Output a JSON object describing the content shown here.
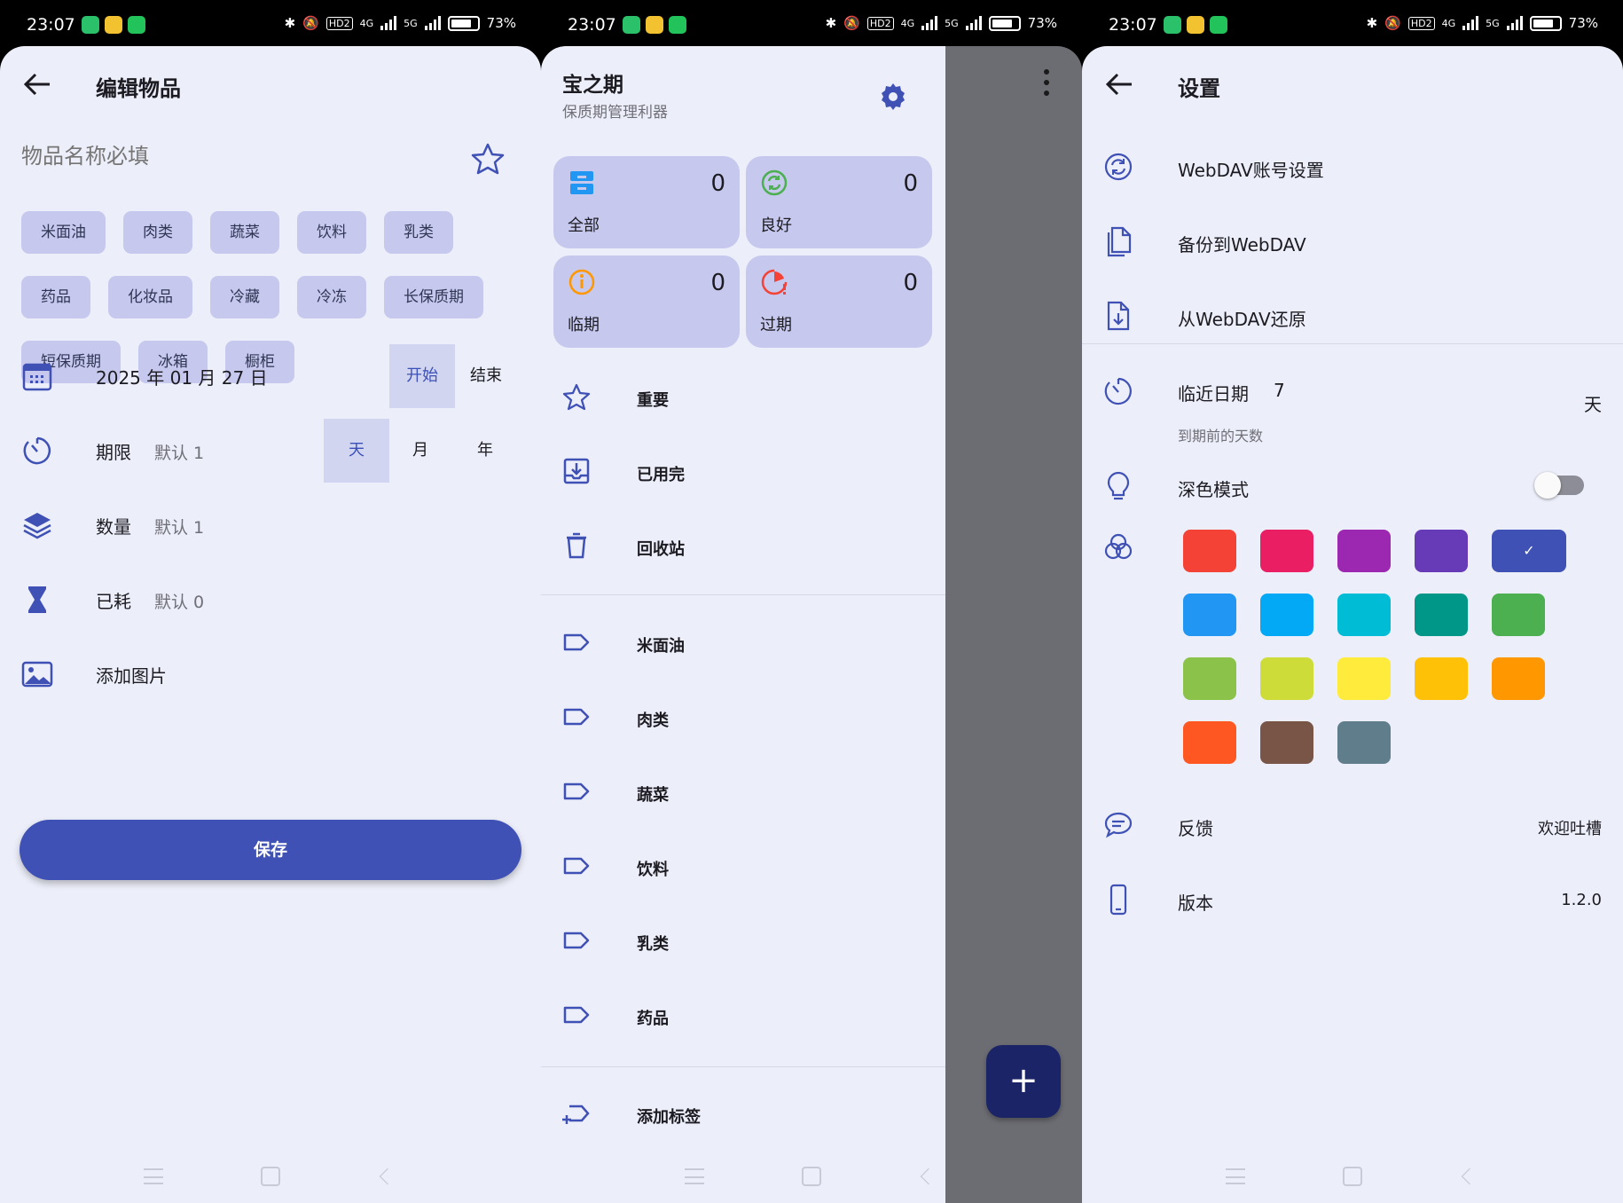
{
  "status": {
    "time": "23:07",
    "battery": "73%",
    "net1": "4G",
    "net2": "5G",
    "hd": "HD2"
  },
  "edit": {
    "title": "编辑物品",
    "name_placeholder": "物品名称必填",
    "tags": [
      "米面油",
      "肉类",
      "蔬菜",
      "饮料",
      "乳类",
      "药品",
      "化妆品",
      "冷藏",
      "冷冻",
      "长保质期",
      "短保质期",
      "冰箱",
      "橱柜"
    ],
    "date": "2025 年 01 月 27 日",
    "date_start": "开始",
    "date_end": "结束",
    "period_label": "期限",
    "period_hint": "默认 1",
    "unit_day": "天",
    "unit_month": "月",
    "unit_year": "年",
    "qty_label": "数量",
    "qty_hint": "默认 1",
    "used_label": "已耗",
    "used_hint": "默认 0",
    "image_label": "添加图片",
    "save": "保存"
  },
  "drawer": {
    "app_name": "宝之期",
    "subtitle": "保质期管理利器",
    "cards": [
      {
        "name": "全部",
        "count": "0"
      },
      {
        "name": "良好",
        "count": "0"
      },
      {
        "name": "临期",
        "count": "0"
      },
      {
        "name": "过期",
        "count": "0"
      }
    ],
    "items": [
      "重要",
      "已用完",
      "回收站"
    ],
    "labels": [
      "米面油",
      "肉类",
      "蔬菜",
      "饮料",
      "乳类",
      "药品"
    ],
    "add_label": "添加标签",
    "fab": "+"
  },
  "settings": {
    "title": "设置",
    "webdav_account": "WebDAV账号设置",
    "backup": "备份到WebDAV",
    "restore": "从WebDAV还原",
    "near_label": "临近日期",
    "near_value": "7",
    "near_unit": "天",
    "near_sub": "到期前的天数",
    "dark_mode": "深色模式",
    "dark_mode_on": false,
    "colors": [
      "#f44336",
      "#e91e63",
      "#9c27b0",
      "#673ab7",
      "#3f51b5",
      "#2196f3",
      "#03a9f4",
      "#00bcd4",
      "#009688",
      "#4caf50",
      "#8bc34a",
      "#cddc39",
      "#ffeb3b",
      "#ffc107",
      "#ff9800",
      "#ff5722",
      "#795548",
      "#607d8b"
    ],
    "selected_color": "#3f51b5",
    "feedback": "反馈",
    "feedback_value": "欢迎吐槽",
    "version": "版本",
    "version_value": "1.2.0"
  }
}
